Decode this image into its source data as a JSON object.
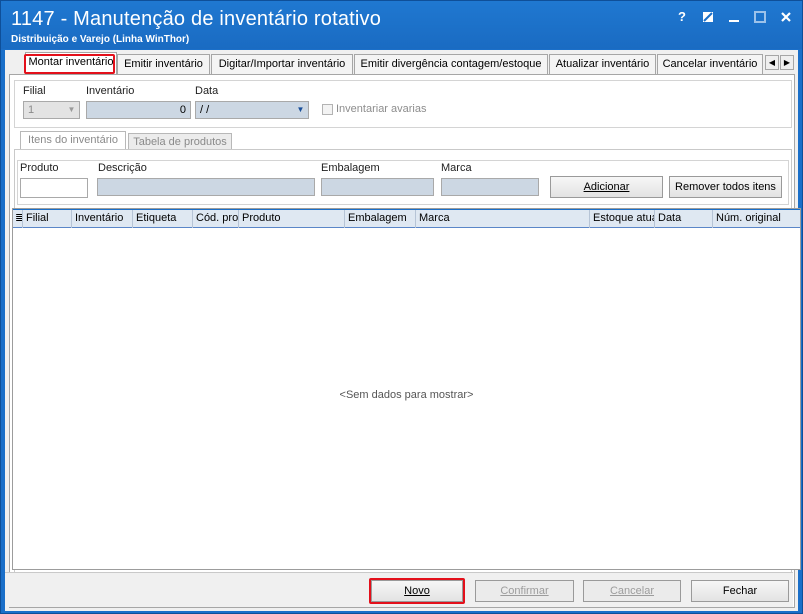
{
  "window": {
    "title": "1147 - Manutenção de inventário rotativo",
    "subtitle": "Distribuição e Varejo (Linha WinThor)",
    "controls": [
      "?",
      "resize-icon",
      "minimize-icon",
      "maximize-icon",
      "close-icon"
    ]
  },
  "tabs": [
    {
      "label": "Montar inventário",
      "active": true,
      "highlighted": true
    },
    {
      "label": "Emitir inventário"
    },
    {
      "label": "Digitar/Importar inventário"
    },
    {
      "label": "Emitir divergência contagem/estoque"
    },
    {
      "label": "Atualizar inventário"
    },
    {
      "label": "Cancelar inventário"
    }
  ],
  "filters": {
    "filial_label": "Filial",
    "filial_value": "1",
    "inventario_label": "Inventário",
    "inventario_value": "0",
    "data_label": "Data",
    "data_value": "/ /",
    "avarias_label": "Inventariar avarias"
  },
  "subtabs": [
    {
      "label": "Itens do inventário",
      "active": true
    },
    {
      "label": "Tabela de produtos"
    }
  ],
  "product_form": {
    "produto_label": "Produto",
    "descricao_label": "Descrição",
    "embalagem_label": "Embalagem",
    "marca_label": "Marca",
    "add_button": "Adicionar",
    "remove_all_button": "Remover todos itens"
  },
  "grid": {
    "columns": [
      "Filial",
      "Inventário",
      "Etiqueta",
      "Cód. pro",
      "Produto",
      "Embalagem",
      "Marca",
      "Estoque atua",
      "Data",
      "Núm. original"
    ],
    "empty_text": "<Sem dados para mostrar>"
  },
  "footer": {
    "novo": "Novo",
    "confirmar": "Confirmar",
    "cancelar": "Cancelar",
    "fechar": "Fechar"
  },
  "colors": {
    "title_bar": "#1a6fc9",
    "highlight": "#e3101b",
    "grid_header": "#dfe8f2"
  }
}
